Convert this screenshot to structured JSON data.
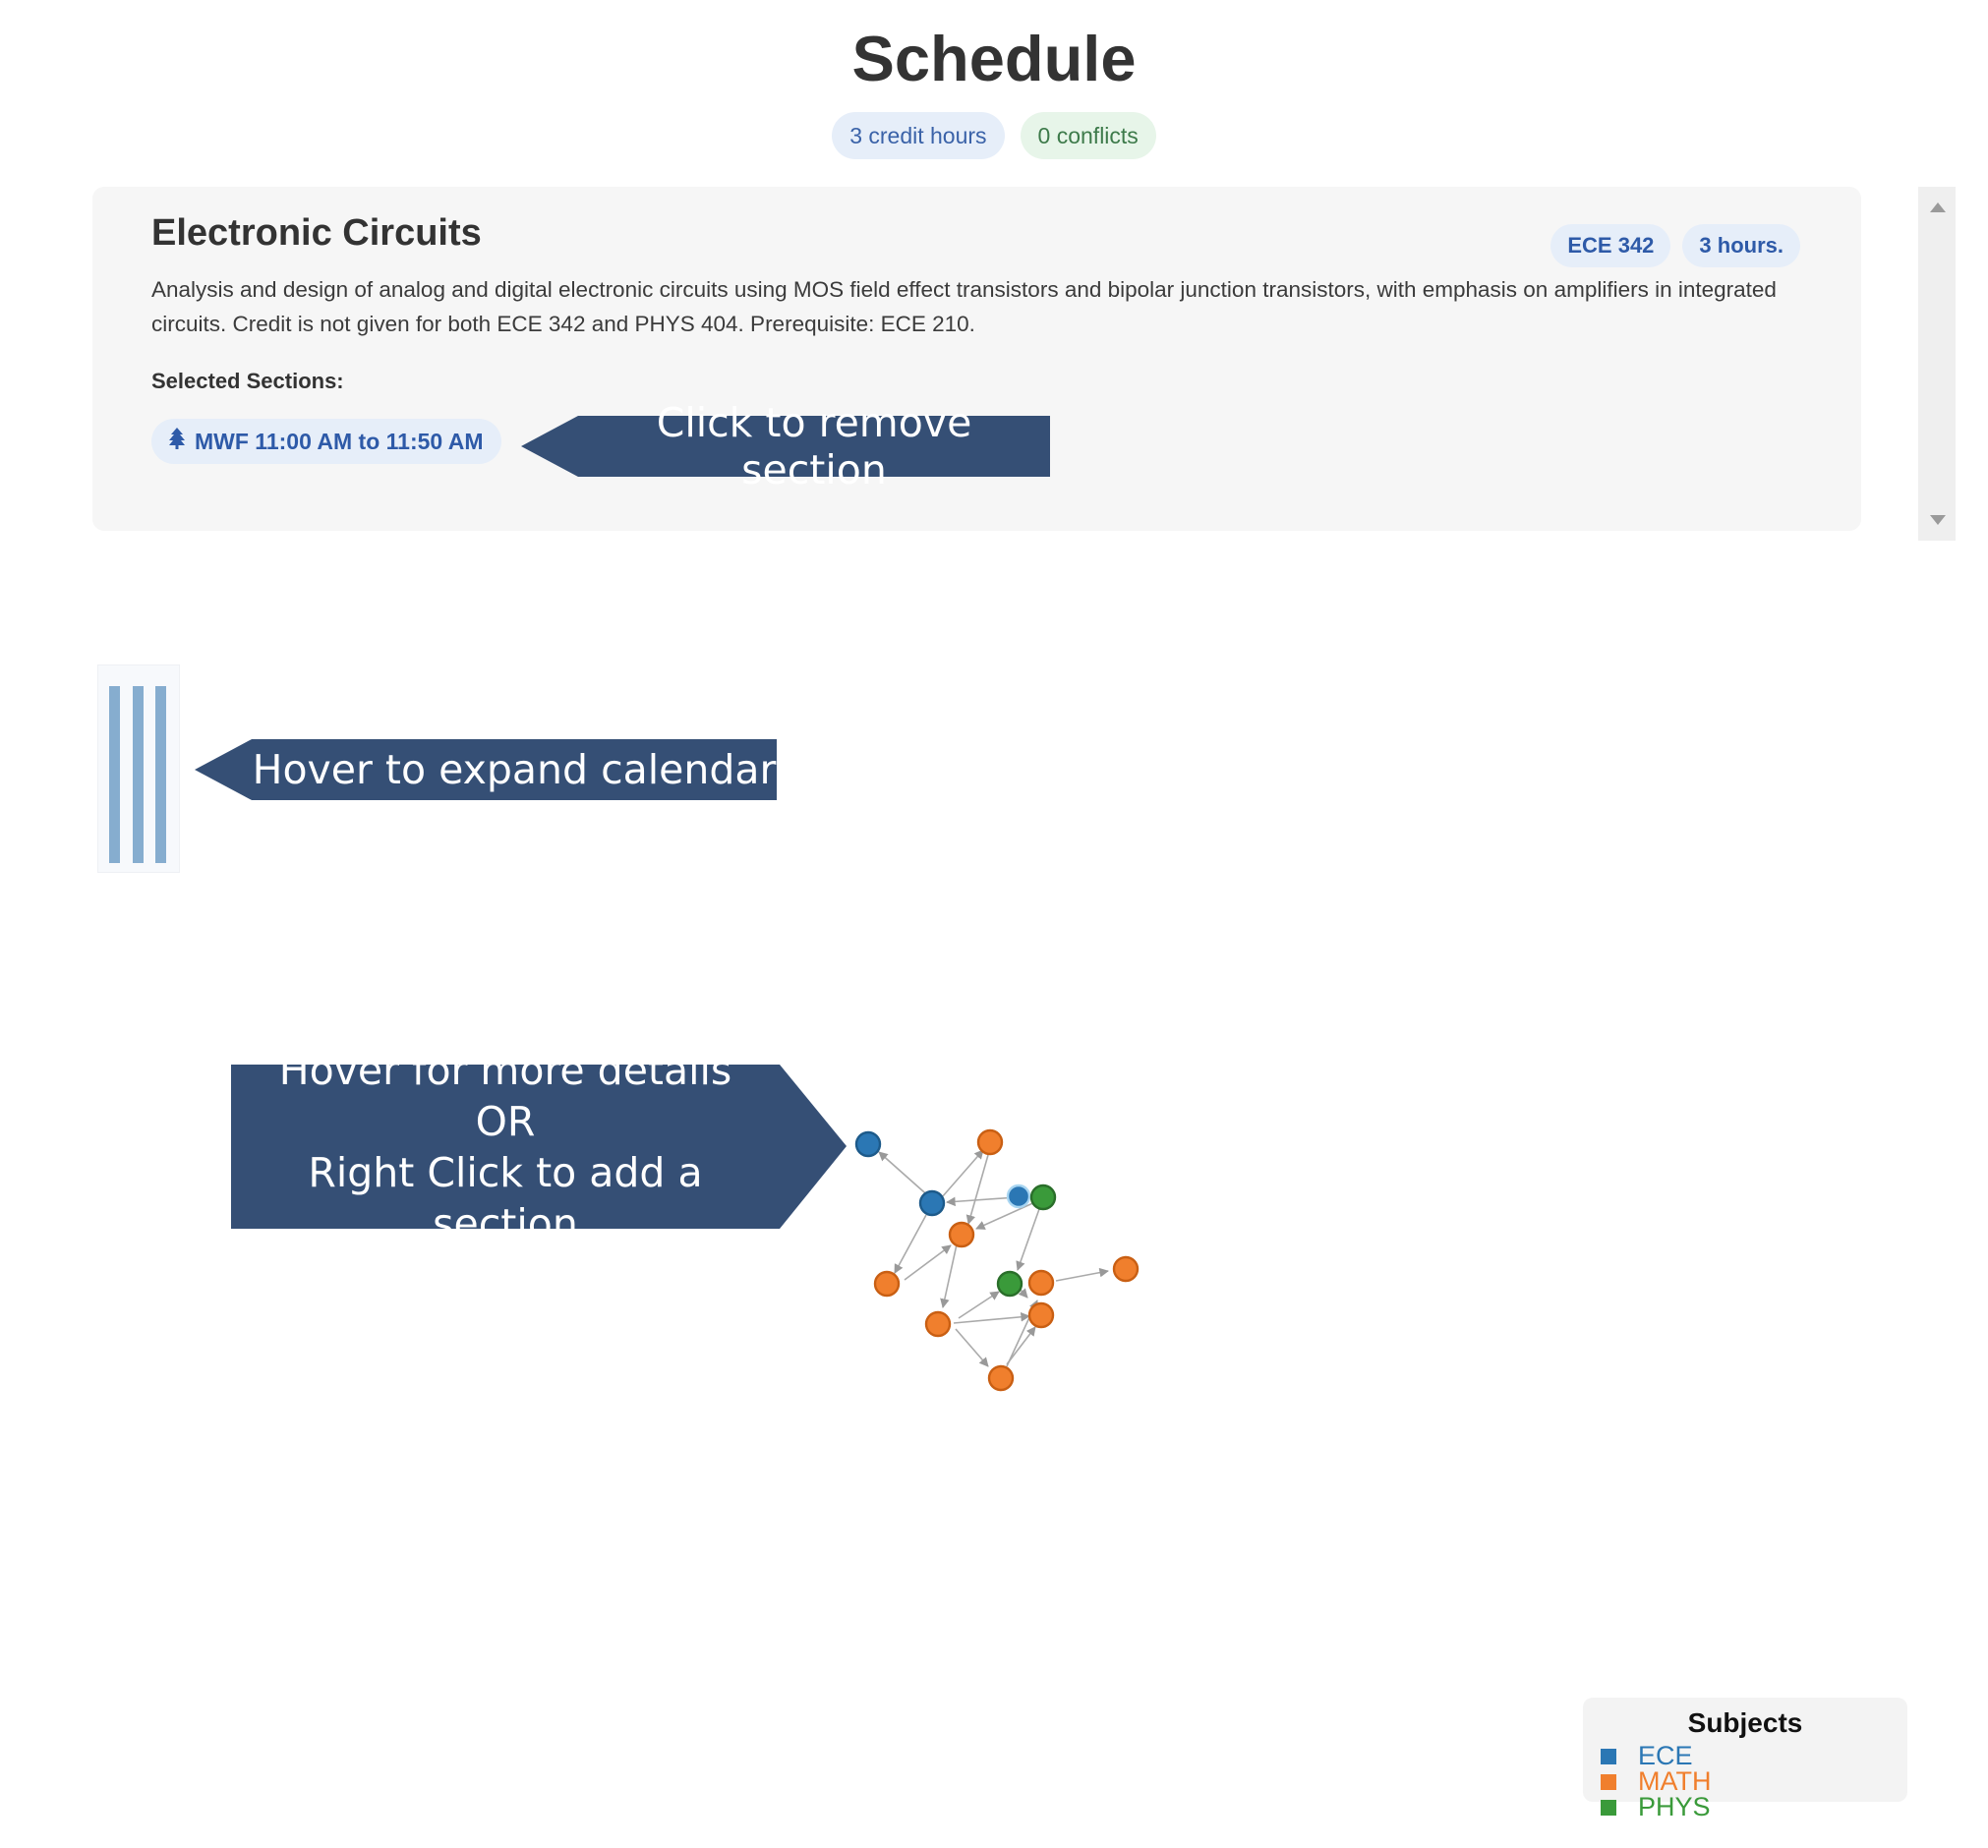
{
  "page_title": "Schedule",
  "summary": {
    "credit_hours": "3 credit hours",
    "conflicts": "0 conflicts"
  },
  "course": {
    "name": "Electronic Circuits",
    "code": "ECE 342",
    "hours": "3 hours.",
    "description": "Analysis and design of analog and digital electronic circuits using MOS field effect transistors and bipolar junction transistors, with emphasis on amplifiers in integrated circuits. Credit is not given for both ECE 342 and PHYS 404. Prerequisite: ECE 210.",
    "selected_label": "Selected Sections:",
    "sections": [
      "MWF 11:00 AM to 11:50 AM"
    ],
    "section_icon": "tree-icon"
  },
  "callouts": {
    "remove_section": "Click to remove section",
    "expand_calendar": "Hover to expand calendar",
    "graph_line1": "Hover for more details",
    "graph_line2": "OR",
    "graph_line3": "Right Click to add a section"
  },
  "legend": {
    "title": "Subjects",
    "items": [
      {
        "label": "ECE",
        "color": "#2b77b4"
      },
      {
        "label": "MATH",
        "color": "#f07f2d"
      },
      {
        "label": "PHYS",
        "color": "#3a9a3a"
      }
    ]
  },
  "colors": {
    "accent_dark": "#354f75",
    "pill_blue_bg": "#e6eef9",
    "pill_green_bg": "#e7f5e9"
  }
}
